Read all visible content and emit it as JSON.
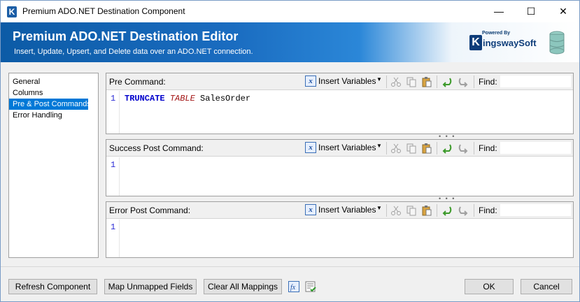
{
  "window": {
    "title": "Premium ADO.NET Destination Component",
    "min_glyph": "—",
    "max_glyph": "☐",
    "close_glyph": "✕",
    "app_icon_letter": "K"
  },
  "banner": {
    "title": "Premium ADO.NET Destination Editor",
    "subtitle": "Insert, Update, Upsert, and Delete data over an ADO.NET connection.",
    "logo_powered": "Powered By",
    "logo_letter": "K",
    "logo_name": "ingswaySoft"
  },
  "sidebar": {
    "items": [
      {
        "label": "General"
      },
      {
        "label": "Columns"
      },
      {
        "label": "Pre & Post Commands"
      },
      {
        "label": "Error Handling"
      }
    ]
  },
  "toolbar": {
    "insert_variables": "Insert Variables",
    "fx_glyph": "x",
    "arrow_glyph": "▼",
    "find_label": "Find:"
  },
  "panels": {
    "pre": {
      "label": "Pre Command:",
      "line_number": "1",
      "code": {
        "kw1": "TRUNCATE",
        "kw2": "TABLE",
        "ident": "SalesOrder"
      }
    },
    "success": {
      "label": "Success Post Command:",
      "line_number": "1"
    },
    "error": {
      "label": "Error Post Command:",
      "line_number": "1"
    }
  },
  "footer": {
    "refresh": "Refresh Component",
    "map_unmapped": "Map Unmapped Fields",
    "clear_all": "Clear All Mappings",
    "ok": "OK",
    "cancel": "Cancel"
  },
  "colors": {
    "accent": "#0078d7",
    "banner_dark": "#0c5ba6",
    "keyword_blue": "#0000cc",
    "keyword_red": "#a31515",
    "line_number": "#2b2bd5"
  }
}
